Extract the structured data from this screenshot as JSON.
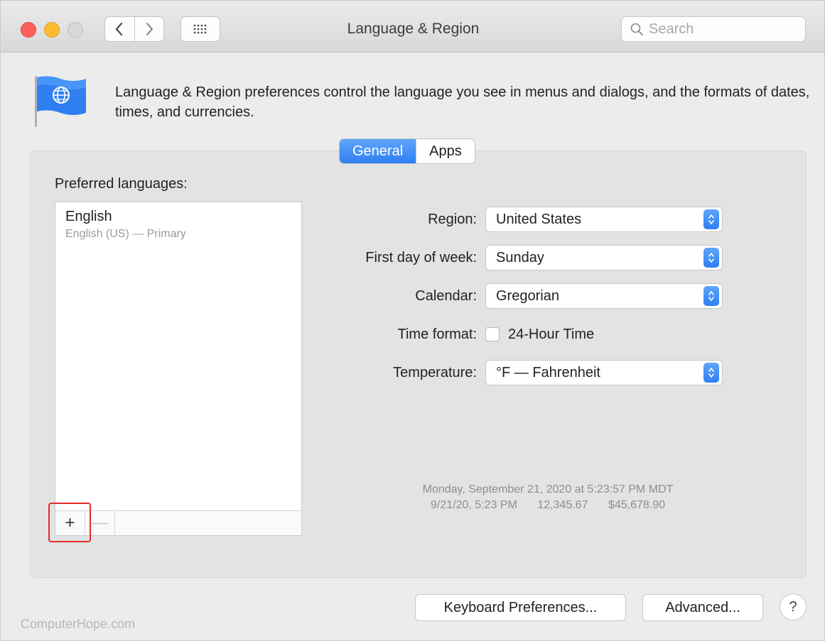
{
  "window": {
    "title": "Language & Region",
    "search_placeholder": "Search"
  },
  "toolbar": {
    "back_icon": "chevron-left-icon",
    "forward_icon": "chevron-right-icon",
    "grid_icon": "show-all-grid-icon"
  },
  "header": {
    "description": "Language & Region preferences control the language you see in menus and dialogs, and the formats of dates, times, and currencies."
  },
  "tabs": [
    {
      "label": "General",
      "active": true
    },
    {
      "label": "Apps",
      "active": false
    }
  ],
  "languages": {
    "heading": "Preferred languages:",
    "items": [
      {
        "name": "English",
        "detail": "English (US) — Primary"
      }
    ],
    "add_label": "+",
    "remove_label": "—"
  },
  "settings": {
    "region": {
      "label": "Region:",
      "value": "United States"
    },
    "first_day": {
      "label": "First day of week:",
      "value": "Sunday"
    },
    "calendar": {
      "label": "Calendar:",
      "value": "Gregorian"
    },
    "time_format": {
      "label": "Time format:",
      "checkbox_label": "24-Hour Time",
      "checked": false
    },
    "temperature": {
      "label": "Temperature:",
      "value": "°F — Fahrenheit"
    }
  },
  "formats_preview": {
    "line1": "Monday, September 21, 2020 at 5:23:57 PM MDT",
    "date": "9/21/20, 5:23 PM",
    "number": "12,345.67",
    "currency": "$45,678.90"
  },
  "buttons": {
    "keyboard": "Keyboard Preferences...",
    "advanced": "Advanced...",
    "help": "?"
  },
  "watermark": "ComputerHope.com",
  "colors": {
    "accent": "#2f7ff2",
    "highlight_box": "#e12b2b"
  }
}
